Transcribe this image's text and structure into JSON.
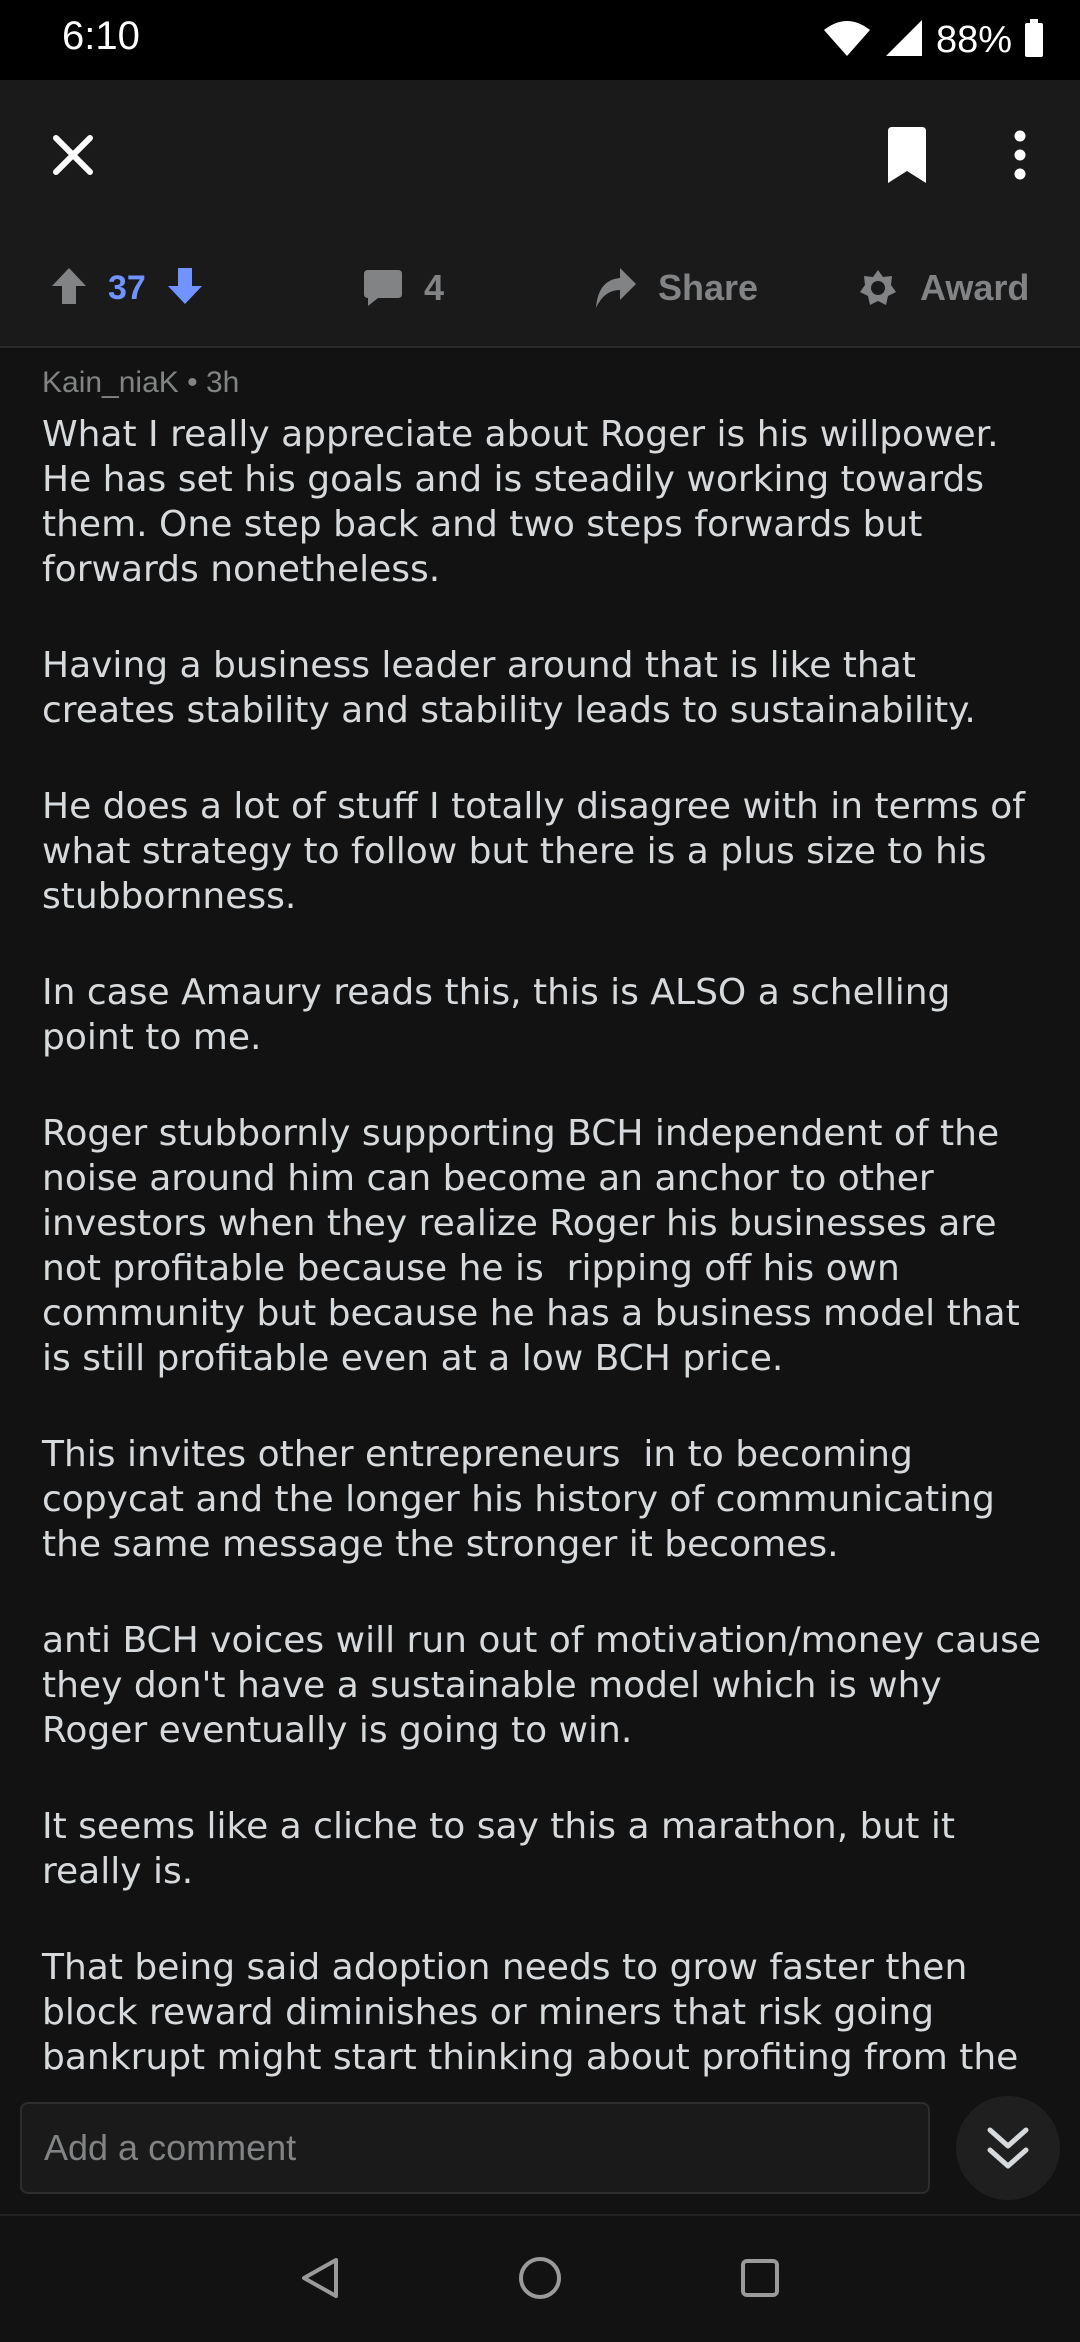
{
  "status_bar": {
    "time": "6:10",
    "battery": "88%"
  },
  "votes": {
    "score": "37"
  },
  "actions": {
    "comments_count": "4",
    "share_label": "Share",
    "award_label": "Award"
  },
  "comment": {
    "author": "Kain_niaK",
    "separator": "•",
    "age": "3h",
    "paragraphs": [
      "What I really appreciate about Roger is his willpower. He has set his goals and is steadily working towards them. One step back and two steps forwards but forwards nonetheless.",
      "Having a business leader around that is like that creates stability and stability leads to sustainability.",
      "He does a lot of stuff I totally disagree with in terms of what strategy to follow but there is a plus size to his stubbornness.",
      "In case Amaury reads this, this is ALSO a schelling point to me.",
      "Roger stubbornly supporting BCH independent of the noise around him can become an anchor to other investors when they realize Roger his businesses are not profitable because he is  ripping off his own community but because he has a business model that is still profitable even at a low BCH price.",
      "This invites other entrepreneurs  in to becoming copycat and the longer his history of communicating the same message the stronger it becomes.",
      "anti BCH voices will run out of motivation/money cause they don't have a sustainable model which is why Roger eventually is going to win.",
      "It seems like a cliche to say this a marathon, but it really is.",
      "That being said adoption needs to grow faster then block reward diminishes or miners that risk going bankrupt might start thinking about profiting from the demise of"
    ]
  },
  "reply": {
    "placeholder": "Add a comment"
  },
  "colors": {
    "background": "#121212",
    "accent_vote": "#7193ff",
    "muted": "#818384"
  }
}
